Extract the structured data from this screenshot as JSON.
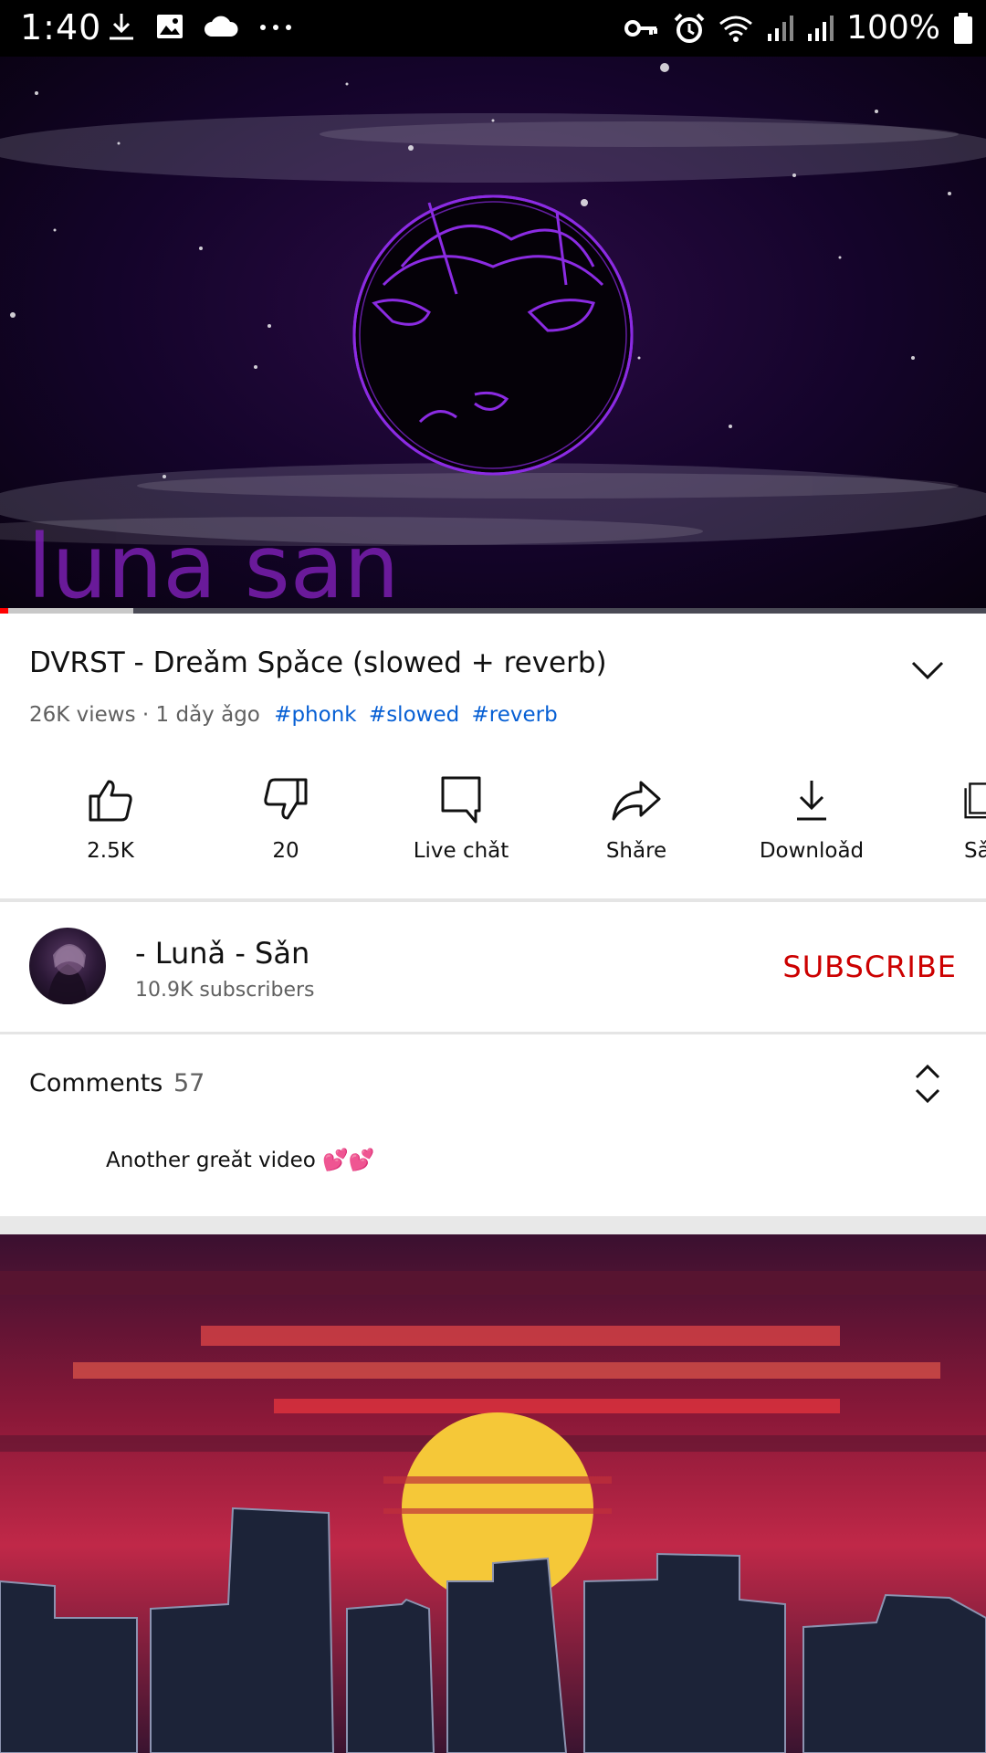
{
  "status_bar": {
    "time": "1:40",
    "left_icons": [
      "download-icon",
      "image-icon",
      "cloud-icon",
      "more-dots-icon"
    ],
    "right_icons": [
      "vpn-key-icon",
      "alarm-icon",
      "wifi-icon",
      "signal-icon",
      "signal-icon",
      "battery-icon"
    ],
    "battery": "100%"
  },
  "player": {
    "watermark": "luna san",
    "progress": 0.0,
    "buffered": 0.135,
    "colors": {
      "progress": "#ff0000",
      "buffer": "#c8c8c8",
      "track": "#4a4a55"
    }
  },
  "video": {
    "title": "DVRST - Dreǎm Spǎce (slowed + reverb)",
    "meta_text": "26K views · 1 dǎy ǎgo",
    "hashtags": [
      "#phonk",
      "#slowed",
      "#reverb"
    ]
  },
  "actions": [
    {
      "icon": "thumbs-up-icon",
      "label": "2.5K"
    },
    {
      "icon": "thumbs-down-icon",
      "label": "20"
    },
    {
      "icon": "live-chat-icon",
      "label": "Live chǎt"
    },
    {
      "icon": "share-icon",
      "label": "Shǎre"
    },
    {
      "icon": "download-icon",
      "label": "Downloǎd"
    },
    {
      "icon": "save-icon",
      "label": "Sǎ"
    }
  ],
  "channel": {
    "name": "- Lunǎ - Sǎn",
    "subscribers": "10.9K subscribers",
    "subscribe_label": "SUBSCRIBE",
    "subscribe_color": "#cc0000"
  },
  "comments": {
    "label": "Comments",
    "count": "57",
    "top_comment": "Another greǎt video 💕💕"
  }
}
